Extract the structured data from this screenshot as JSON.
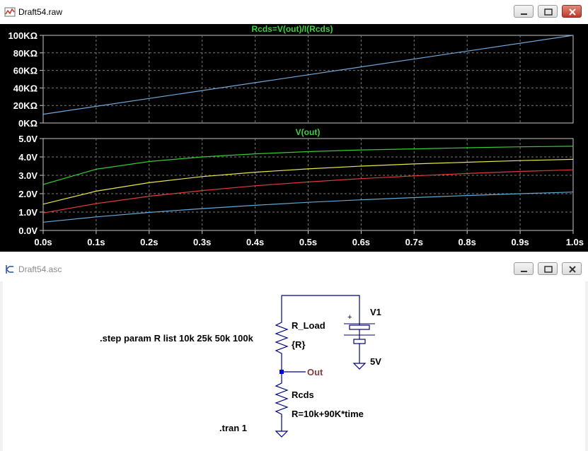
{
  "plot_window": {
    "title": "Draft54.raw",
    "icon": "waveform-icon",
    "panes": [
      {
        "title": "Rcds=V(out)/I(Rcds)",
        "title_color": "#3fd23f"
      },
      {
        "title": "V(out)",
        "title_color": "#3fd23f"
      }
    ]
  },
  "schematic_window": {
    "title": "Draft54.asc",
    "icon": "schematic-icon",
    "labels": {
      "r_load_name": "R_Load",
      "r_load_value": "{R}",
      "rcds_name": "Rcds",
      "rcds_value": "R=10k+90K*time",
      "source_name": "V1",
      "source_value": "5V",
      "source_plus": "+",
      "net_label": "Out",
      "step_directive": ".step param R list 10k 25k 50k 100k",
      "tran_directive": ".tran 1"
    }
  },
  "chart_data": [
    {
      "type": "line",
      "title": "Rcds=V(out)/I(Rcds)",
      "y_unit": "KΩ",
      "yticks": [
        "0KΩ",
        "20KΩ",
        "40KΩ",
        "60KΩ",
        "80KΩ",
        "100KΩ"
      ],
      "xlim": [
        0,
        1
      ],
      "ylim": [
        0,
        100
      ],
      "grid": true,
      "series": [
        {
          "color": "#6fa8dc",
          "x": [
            0,
            1
          ],
          "y": [
            10,
            100
          ]
        }
      ]
    },
    {
      "type": "line",
      "title": "V(out)",
      "yticks": [
        "0.0V",
        "1.0V",
        "2.0V",
        "3.0V",
        "4.0V",
        "5.0V"
      ],
      "xticks": [
        "0.0s",
        "0.1s",
        "0.2s",
        "0.3s",
        "0.4s",
        "0.5s",
        "0.6s",
        "0.7s",
        "0.8s",
        "0.9s",
        "1.0s"
      ],
      "xlim": [
        0,
        1
      ],
      "ylim": [
        0,
        5
      ],
      "grid": true,
      "series": [
        {
          "color": "#33cc33",
          "x": [
            0,
            0.1,
            0.2,
            0.3,
            0.4,
            0.5,
            0.6,
            0.7,
            0.8,
            0.9,
            1.0
          ],
          "y": [
            2.5,
            3.33,
            3.75,
            4.0,
            4.17,
            4.29,
            4.38,
            4.44,
            4.5,
            4.55,
            4.58
          ]
        },
        {
          "color": "#e8e84a",
          "x": [
            0,
            0.1,
            0.2,
            0.3,
            0.4,
            0.5,
            0.6,
            0.7,
            0.8,
            0.9,
            1.0
          ],
          "y": [
            1.43,
            2.14,
            2.6,
            2.93,
            3.17,
            3.35,
            3.5,
            3.62,
            3.71,
            3.8,
            3.87
          ]
        },
        {
          "color": "#e03b3b",
          "x": [
            0,
            0.1,
            0.2,
            0.3,
            0.4,
            0.5,
            0.6,
            0.7,
            0.8,
            0.9,
            1.0
          ],
          "y": [
            0.95,
            1.46,
            1.86,
            2.17,
            2.43,
            2.64,
            2.82,
            2.97,
            3.1,
            3.21,
            3.3
          ]
        },
        {
          "color": "#5fa9d9",
          "x": [
            0,
            0.1,
            0.2,
            0.3,
            0.4,
            0.5,
            0.6,
            0.7,
            0.8,
            0.9,
            1.0
          ],
          "y": [
            0.45,
            0.74,
            0.98,
            1.19,
            1.37,
            1.53,
            1.67,
            1.79,
            1.9,
            2.0,
            2.09
          ]
        }
      ]
    }
  ]
}
